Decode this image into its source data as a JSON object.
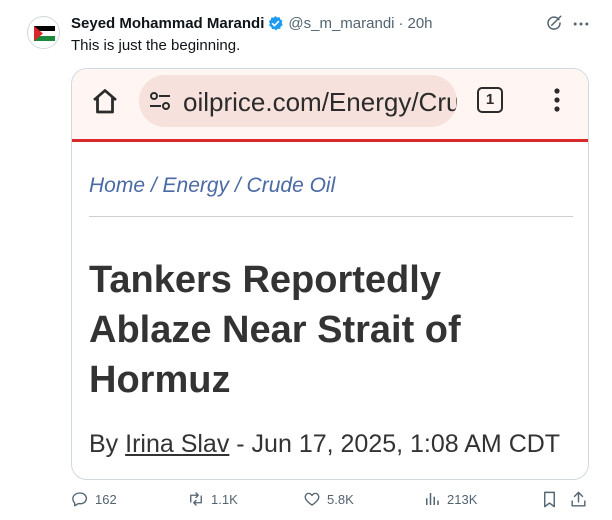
{
  "author": {
    "display_name": "Seyed Mohammad Marandi",
    "handle": "@s_m_marandi",
    "separator": "·",
    "time": "20h",
    "verified_icon": "verified-badge-icon"
  },
  "tweet": {
    "text": "This is just the beginning."
  },
  "media": {
    "browser": {
      "url": "oilprice.com/Energy/Cru",
      "tab_count": "1"
    },
    "breadcrumb": "Home / Energy / Crude Oil",
    "headline": "Tankers Reportedly Ablaze Near Strait of Hormuz",
    "byline": {
      "prefix": "By ",
      "author": "Irina Slav",
      "suffix": " - Jun 17, 2025, 1:08 AM CDT"
    }
  },
  "actions": {
    "replies": "162",
    "reposts": "1.1K",
    "likes": "5.8K",
    "views": "213K"
  },
  "colors": {
    "accent_red": "#d8282a",
    "verified_blue": "#1d9bf0",
    "breadcrumb_blue": "#4a6aa5",
    "muted": "#536471"
  }
}
